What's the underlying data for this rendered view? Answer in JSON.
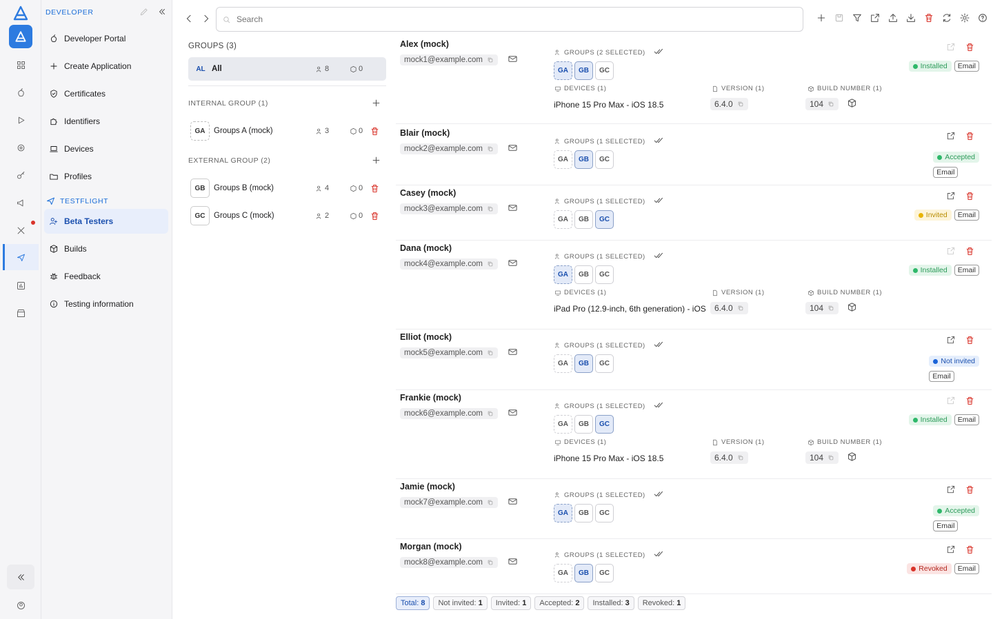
{
  "sidebar": {
    "section_developer": "DEVELOPER",
    "section_testflight": "TESTFLIGHT",
    "items": [
      {
        "label": "Developer Portal",
        "icon": "apple-icon"
      },
      {
        "label": "Create Application",
        "icon": "plus-icon"
      },
      {
        "label": "Certificates",
        "icon": "certificate-icon"
      },
      {
        "label": "Identifiers",
        "icon": "puzzle-icon"
      },
      {
        "label": "Devices",
        "icon": "laptop-icon"
      },
      {
        "label": "Profiles",
        "icon": "folder-icon"
      },
      {
        "label": "Beta Testers",
        "icon": "users-icon"
      },
      {
        "label": "Builds",
        "icon": "cube-icon"
      },
      {
        "label": "Feedback",
        "icon": "bug-icon"
      },
      {
        "label": "Testing information",
        "icon": "info-icon"
      }
    ]
  },
  "search": {
    "placeholder": "Search"
  },
  "groups": {
    "header": "GROUPS (3)",
    "all": {
      "badge": "AL",
      "label": "All",
      "users": "8",
      "devices": "0"
    },
    "internal_header": "INTERNAL GROUP (1)",
    "external_header": "EXTERNAL GROUP (2)",
    "internal": [
      {
        "badge": "GA",
        "label": "Groups A (mock)",
        "users": "3",
        "devices": "0"
      }
    ],
    "external": [
      {
        "badge": "GB",
        "label": "Groups B (mock)",
        "users": "4",
        "devices": "0"
      },
      {
        "badge": "GC",
        "label": "Groups C (mock)",
        "users": "2",
        "devices": "0"
      }
    ]
  },
  "labels": {
    "devices": "DEVICES (1)",
    "version": "VERSION (1)",
    "build": "BUILD NUMBER (1)",
    "email_button": "Email"
  },
  "status_colors": {
    "Installed": "#2fb86a",
    "Accepted": "#2fb86a",
    "Invited": "#e8b400",
    "Not invited": "#1a63d8",
    "Revoked": "#d9342b"
  },
  "testers": [
    {
      "name": "Alex (mock)",
      "email": "mock1@example.com",
      "groups_label": "GROUPS (2 SELECTED)",
      "selected": [
        "GA",
        "GB"
      ],
      "status": "Installed",
      "device": "iPhone 15 Pro Max - iOS 18.5",
      "version": "6.4.0",
      "build": "104"
    },
    {
      "name": "Blair (mock)",
      "email": "mock2@example.com",
      "groups_label": "GROUPS (1 SELECTED)",
      "selected": [
        "GB"
      ],
      "status": "Accepted"
    },
    {
      "name": "Casey (mock)",
      "email": "mock3@example.com",
      "groups_label": "GROUPS (1 SELECTED)",
      "selected": [
        "GC"
      ],
      "status": "Invited"
    },
    {
      "name": "Dana (mock)",
      "email": "mock4@example.com",
      "groups_label": "GROUPS (1 SELECTED)",
      "selected": [
        "GA"
      ],
      "status": "Installed",
      "device": "iPad Pro (12.9-inch, 6th generation) - iOS",
      "version": "6.4.0",
      "build": "104"
    },
    {
      "name": "Elliot (mock)",
      "email": "mock5@example.com",
      "groups_label": "GROUPS (1 SELECTED)",
      "selected": [
        "GB"
      ],
      "status": "Not invited"
    },
    {
      "name": "Frankie (mock)",
      "email": "mock6@example.com",
      "groups_label": "GROUPS (1 SELECTED)",
      "selected": [
        "GC"
      ],
      "status": "Installed",
      "device": "iPhone 15 Pro Max - iOS 18.5",
      "version": "6.4.0",
      "build": "104"
    },
    {
      "name": "Jamie (mock)",
      "email": "mock7@example.com",
      "groups_label": "GROUPS (1 SELECTED)",
      "selected": [
        "GA"
      ],
      "status": "Accepted"
    },
    {
      "name": "Morgan (mock)",
      "email": "mock8@example.com",
      "groups_label": "GROUPS (1 SELECTED)",
      "selected": [
        "GB"
      ],
      "status": "Revoked"
    }
  ],
  "footer": [
    {
      "label": "Total:",
      "value": "8"
    },
    {
      "label": "Not invited:",
      "value": "1"
    },
    {
      "label": "Invited:",
      "value": "1"
    },
    {
      "label": "Accepted:",
      "value": "2"
    },
    {
      "label": "Installed:",
      "value": "3"
    },
    {
      "label": "Revoked:",
      "value": "1"
    }
  ]
}
